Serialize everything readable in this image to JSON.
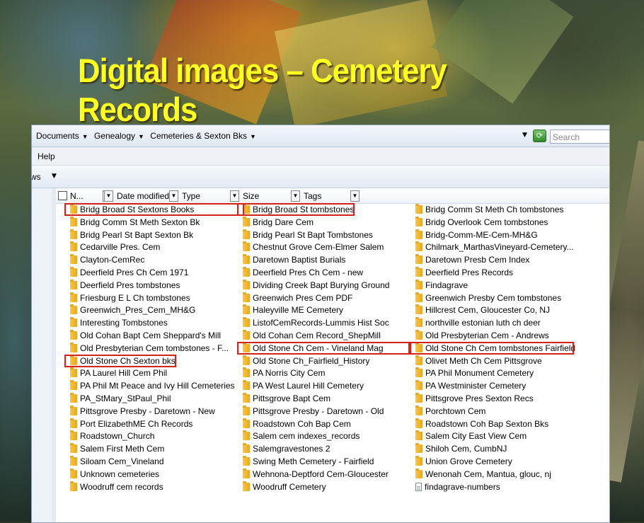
{
  "slide_title": "Digital images – Cemetery Records",
  "address": {
    "crumbs": [
      "Documents",
      "Genealogy",
      "Cemeteries & Sexton Bks"
    ],
    "search_placeholder": "Search"
  },
  "menu": {
    "help": "Help"
  },
  "toolbar": {
    "views_label": "ws"
  },
  "columns": {
    "name": "N...",
    "date_modified": "Date modified",
    "type": "Type",
    "size": "Size",
    "tags": "Tags"
  },
  "highlight_color": "#d6201a",
  "files": {
    "col1": [
      "Bridg Broad St Sextons Books",
      "Bridg Comm St Meth Sexton Bk",
      "Bridg Pearl St Bapt Sexton Bk",
      "Cedarville Pres. Cem",
      "Clayton-CemRec",
      "Deerfield Pres Ch Cem 1971",
      "Deerfield Pres tombstones",
      "Friesburg E L Ch tombstones",
      "Greenwich_Pres_Cem_MH&G",
      "Interesting Tombstones",
      "Old Cohan Bapt Cem Sheppard's Mill",
      "Old Presbyterian Cem tombstones - F...",
      "Old Stone Ch Sexton bks",
      "PA Laurel Hill Cem Phil",
      "PA Phil Mt Peace and Ivy Hill Cemeteries",
      "PA_StMary_StPaul_Phil",
      "Pittsgrove Presby - Daretown - New",
      "Port ElizabethME Ch Records",
      "Roadstown_Church",
      "Salem First Meth Cem",
      "Siloam Cem_Vineland",
      "Unknown cemeteries",
      "Woodruff cem records"
    ],
    "col2": [
      "Bridg Broad St tombstones",
      "Bridg Dare Cem",
      "Bridg Pearl St Bapt Tombstones",
      "Chestnut Grove Cem-Elmer Salem",
      "Daretown Baptist Burials",
      "Deerfield Pres Ch Cem - new",
      "Dividing Creek Bapt Burying Ground",
      "Greenwich Pres Cem PDF",
      "Haleyville ME Cemetery",
      "ListofCemRecords-Lummis Hist Soc",
      "Old Cohan Cem Record_ShepMill",
      "Old Stone Ch Cem - Vineland Mag",
      "Old Stone Ch_Fairfield_History",
      "PA Norris City Cem",
      "PA West Laurel Hill Cemetery",
      "Pittsgrove Bapt Cem",
      "Pittsgrove Presby - Daretown - Old",
      "Roadstown Coh Bap Cem",
      "Salem cem indexes_records",
      "Salemgravestones 2",
      "Swing Meth Cemetery - Fairfield",
      "Wehnona-Deptford Cem-Gloucester",
      "Woodruff Cemetery"
    ],
    "col3": [
      "Bridg Comm St Meth Ch tombstones",
      "Bridg Overlook Cem tombstones",
      "Bridg-Comm-ME-Cem-MH&G",
      "Chilmark_MarthasVineyard-Cemetery...",
      "Daretown Presb Cem Index",
      "Deerfield Pres Records",
      "Findagrave",
      "Greenwich Presby Cem tombstones",
      "Hillcrest Cem, Gloucester Co, NJ",
      "northville estonian luth ch deer",
      "Old Presbyterian Cem - Andrews",
      "Old Stone Ch Cem tombstones Fairfield",
      "Olivet Meth Ch Cem Pittsgrove",
      "PA Phil Monument Cemetery",
      "PA Westminister Cemetery",
      "Pittsgrove Pres Sexton Recs",
      "Porchtown Cem",
      "Roadstown Coh Bap Sexton Bks",
      "Salem City East View Cem",
      "Shiloh Cem, CumbNJ",
      "Union Grove Cemetery",
      "Wenonah Cem, Mantua, glouc, nj",
      "findagrave-numbers"
    ]
  }
}
